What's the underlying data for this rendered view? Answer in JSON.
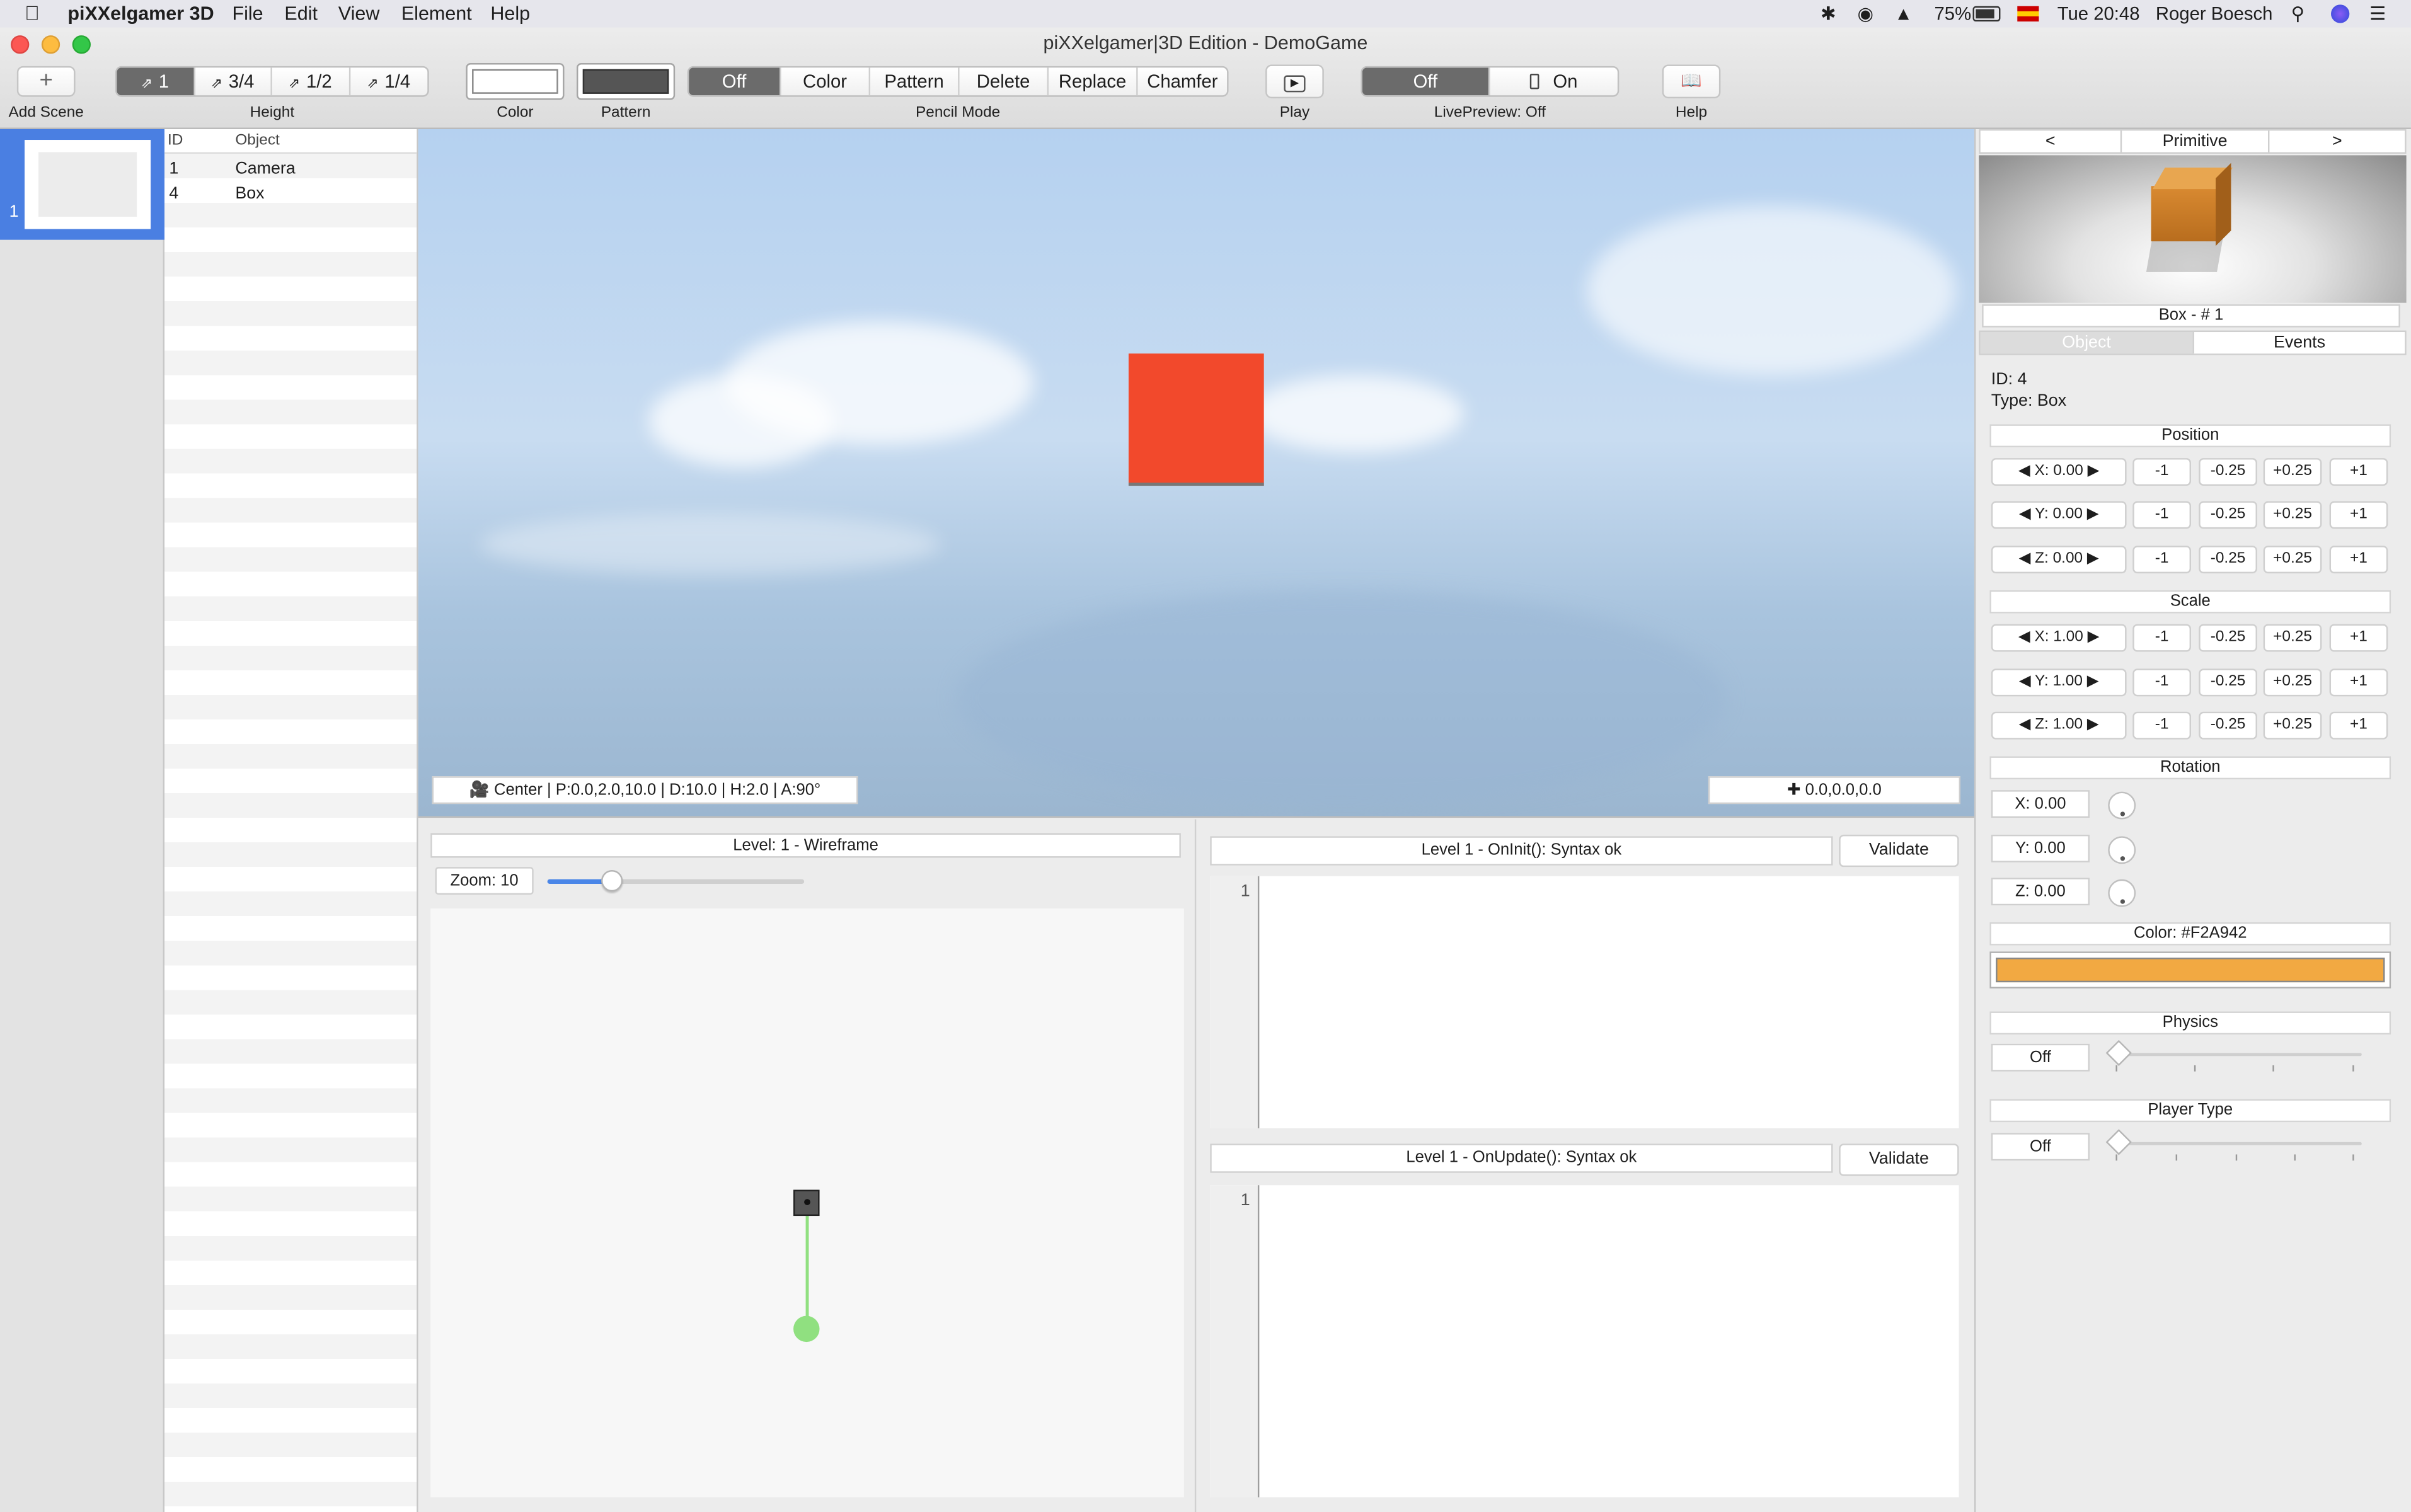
{
  "menubar": {
    "app_name": "piXXelgamer 3D",
    "menus": [
      "File",
      "Edit",
      "View",
      "Element",
      "Help"
    ],
    "battery": "75%",
    "clock": "Tue 20:48",
    "user": "Roger Boesch"
  },
  "window": {
    "title": "piXXelgamer|3D Edition - DemoGame"
  },
  "toolbar": {
    "add_scene_icon": "+",
    "add_scene_label": "Add Scene",
    "height_options": [
      "1",
      "3/4",
      "1/2",
      "1/4"
    ],
    "height_label": "Height",
    "color_label": "Color",
    "pattern_label": "Pattern",
    "pencil_modes": [
      "Off",
      "Color",
      "Pattern",
      "Delete",
      "Replace",
      "Chamfer"
    ],
    "pencil_label": "Pencil Mode",
    "play_label": "Play",
    "livepreview_options": [
      "Off",
      "On"
    ],
    "livepreview_label": "LivePreview: Off",
    "help_label": "Help"
  },
  "scenes": {
    "items": [
      {
        "number": "1"
      }
    ]
  },
  "object_list": {
    "headers": [
      "ID",
      "Object"
    ],
    "rows": [
      {
        "id": "1",
        "name": "Camera"
      },
      {
        "id": "4",
        "name": "Box"
      }
    ]
  },
  "viewport": {
    "camera_info": "Center | P:0.0,2.0,10.0 | D:10.0 | H:2.0 | A:90°",
    "cursor_info": "0.0,0.0,0.0"
  },
  "wireframe": {
    "title": "Level: 1 - Wireframe",
    "zoom_label": "Zoom: 10",
    "zoom_fraction": 0.25
  },
  "scripts": {
    "oninit_title": "Level 1 - OnInit(): Syntax ok",
    "onupdate_title": "Level 1 - OnUpdate(): Syntax ok",
    "validate_label": "Validate",
    "line_number": "1"
  },
  "inspector": {
    "nav_prev": "<",
    "nav_title": "Primitive",
    "nav_next": ">",
    "preview_caption": "Box - # 1",
    "tabs": [
      "Object",
      "Events"
    ],
    "id_line": "ID: 4",
    "type_line": "Type: Box",
    "position_header": "Position",
    "position": [
      "X: 0.00",
      "Y: 0.00",
      "Z: 0.00"
    ],
    "scale_header": "Scale",
    "scale": [
      "X: 1.00",
      "Y: 1.00",
      "Z: 1.00"
    ],
    "step_buttons": [
      "-1",
      "-0.25",
      "+0.25",
      "+1"
    ],
    "rotation_header": "Rotation",
    "rotation": [
      "X: 0.00",
      "Y: 0.00",
      "Z: 0.00"
    ],
    "color_header": "Color: #F2A942",
    "color_value": "#F2A942",
    "physics_header": "Physics",
    "physics_value": "Off",
    "player_type_header": "Player Type",
    "player_type_value": "Off"
  },
  "colors": {
    "accent": "#4a7fe2",
    "cube": "#f2492c",
    "wire_line": "#90e080"
  }
}
